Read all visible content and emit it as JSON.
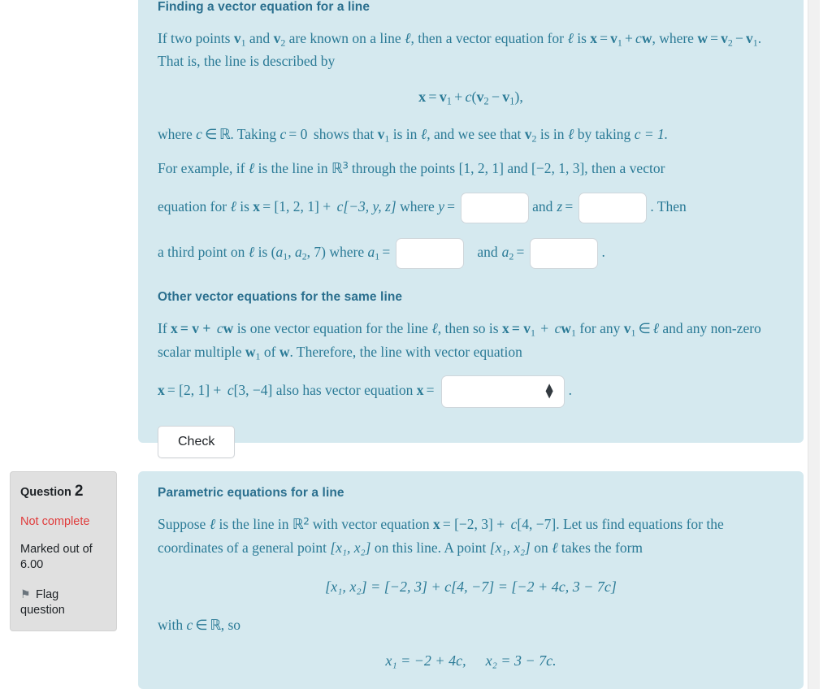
{
  "app": {
    "background": "#ffffff",
    "content_panel_color": "#d5e9ef",
    "info_panel_color": "#e0e0e0",
    "accent_text_color": "#2a7a96",
    "alert_color": "#e03c3c"
  },
  "questions": [
    {
      "info": {
        "visible": false,
        "label": "",
        "number": "",
        "state": "",
        "grade_line1": "",
        "grade_line2": "",
        "flag_label": "",
        "flag_label_line2": "",
        "flag_icon": "flag-icon"
      },
      "content": {
        "section1_title": "Finding a vector equation for a line",
        "p1_a": "If two points ",
        "p1_v1": "v",
        "p1_v1_sub": "1",
        "p1_b": "  and ",
        "p1_v2": "v",
        "p1_v2_sub": "2",
        "p1_c": "  are known on a line ",
        "p1_ell": "ℓ",
        "p1_d": ", then a vector equation for ",
        "p1_e": " is ",
        "p1_x": "x",
        "p1_eq": "=",
        "p1_f": "+",
        "p1_c_var": "c",
        "p1_w": "w",
        "p1_comma": ",",
        "p2_a": "where ",
        "p2_w": "w",
        "p2_eq": "=",
        "p2_v2": "v",
        "p2_minus": "−",
        "p2_v1": "v",
        "p2_b": ". That is, the line is described by",
        "display1": "x = v₁ + c(v₂ − v₁),",
        "p3_a": "where ",
        "p3_c": "c",
        "p3_in": "∈",
        "p3_R": "ℝ",
        "p3_b": ". Taking ",
        "p3_c2": "c",
        "p3_eq0": "= 0",
        "p3_d": " shows that ",
        "p3_v1": "v",
        "p3_e": "  is in ",
        "p3_f": ", and we see that ",
        "p3_v2": "v",
        "p3_g": "  is in ",
        "p3_h": " by taking",
        "p3_i": "c = 1.",
        "p4_a": "For example, if ",
        "p4_b": " is the line in ",
        "p4_R": "ℝ",
        "p4_R_sup": "3",
        "p4_c": "  through the points ",
        "p4_pt1": "[1, 2, 1]",
        "p4_and": " and ",
        "p4_pt2": "[−2, 1, 3]",
        "p4_d": ", then a vector",
        "p5_a": "equation for ",
        "p5_b": " is ",
        "p5_x": "x",
        "p5_eq": "= [1, 2, 1] + ",
        "p5_c": "c",
        "p5_vec": "[−3, y, z]",
        "p5_where": " where ",
        "p5_y": "y",
        "p5_eq2": "=",
        "p5_and": "and",
        "p5_z": "z",
        "p5_eq3": "=",
        "p5_then": ". Then",
        "p6_a": "a third point on ",
        "p6_b": " is (",
        "p6_a1": "a",
        "p6_a1_sub": "1",
        "p6_comma": ", ",
        "p6_a2": "a",
        "p6_a2_sub": "2",
        "p6_seven": ", 7) where ",
        "p6_a1_lbl": "a",
        "p6_eq": "=",
        "p6_and": "and",
        "p6_a2_lbl": "a",
        "p6_eq2": "=",
        "p6_period": ".",
        "section2_title": "Other vector equations for the same line",
        "p7_a": "If ",
        "p7_x": "x",
        "p7_eq": "= v + ",
        "p7_c": "c",
        "p7_w": "w",
        "p7_b": " is one vector equation for the line ",
        "p7_c2": ", then so is ",
        "p7_x2": "x",
        "p7_eq2": "= v",
        "p7_sub1": "1",
        "p7_plus": "+ ",
        "p7_cw1": "c",
        "p7_w1": "w",
        "p7_w1_sub": "1",
        "p7_for": "  for any ",
        "p7_v1": "v",
        "p7_v1_sub": "1",
        "p7_in": "∈",
        "p8_a": "and any non-zero scalar multiple ",
        "p8_w1": "w",
        "p8_w1_sub": "1",
        "p8_b": "  of ",
        "p8_w": "w",
        "p8_c": ". Therefore, the line with vector equation",
        "p9_x": "x",
        "p9_eq": "= [2, 1] + ",
        "p9_c": "c",
        "p9_vec": "[3, −4]",
        "p9_b": " also has vector equation ",
        "p9_x2": "x",
        "p9_eq2": "=",
        "p9_period": ".",
        "inputs": {
          "y_value": "",
          "y_placeholder": "",
          "z_value": "",
          "z_placeholder": "",
          "a1_value": "",
          "a1_placeholder": "",
          "a2_value": "",
          "a2_placeholder": "",
          "select_value": ""
        },
        "check_label": "Check"
      }
    },
    {
      "info": {
        "visible": true,
        "label": "Question",
        "number": "2",
        "state": "Not complete",
        "grade_line1": "Marked out of",
        "grade_line2": "6.00",
        "flag_label": "Flag",
        "flag_label_line2": "question",
        "flag_icon": "flag-icon"
      },
      "content": {
        "section1_title": "Parametric equations for a line",
        "p1_a": "Suppose ",
        "p1_ell": "ℓ",
        "p1_b": " is the line in ",
        "p1_R": "ℝ",
        "p1_R_sup": "2",
        "p1_c": "  with vector equation ",
        "p1_x": "x",
        "p1_eq": "= [−2, 3] + ",
        "p1_cvar": "c",
        "p1_vec": "[4, −7]",
        "p1_d": ". Let us find",
        "p2_a": "equations for the coordinates of a general point ",
        "p2_pt": "[x₁, x₂]",
        "p2_b": " on this line. A point ",
        "p2_pt2": "[x₁, x₂]",
        "p2_c": " on ",
        "p2_d": "",
        "p3_a": "takes the form",
        "display1": "[x₁, x₂] = [−2, 3] + c[4, −7] = [−2 + 4c, 3 − 7c]",
        "p4_a": "with ",
        "p4_c": "c",
        "p4_in": "∈",
        "p4_R": "ℝ",
        "p4_b": ", so",
        "display2_a": "x₁ = −2 + 4c,",
        "display2_b": "x₂ = 3 − 7c."
      }
    }
  ]
}
